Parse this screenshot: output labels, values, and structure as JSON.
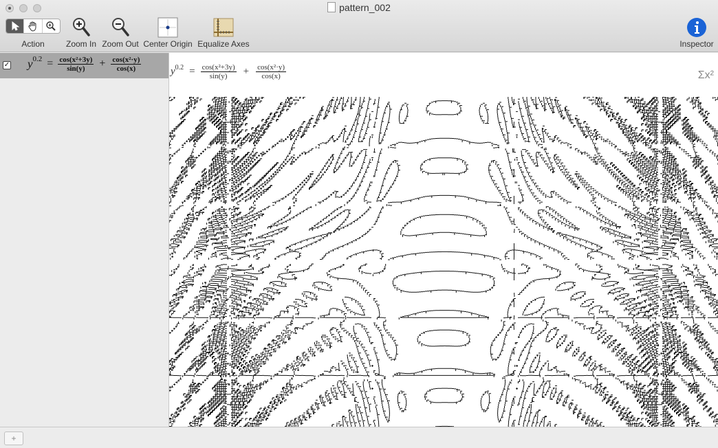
{
  "window": {
    "title": "pattern_002"
  },
  "toolbar": {
    "action_label": "Action",
    "zoom_in_label": "Zoom In",
    "zoom_out_label": "Zoom Out",
    "center_origin_label": "Center Origin",
    "equalize_axes_label": "Equalize Axes",
    "inspector_label": "Inspector"
  },
  "equation": {
    "checked": true,
    "lhs_base": "y",
    "lhs_exp": "0.2",
    "equals": "=",
    "plus": "+",
    "t1_num": "cos(x²+3y)",
    "t1_den": "sin(y)",
    "t2_num": "cos(x²·y)",
    "t2_den": "cos(x)"
  },
  "formula_bar": {
    "sigma": "Σx²"
  },
  "status": {
    "add_label": "+"
  },
  "colors": {
    "accent": "#1a63d6",
    "selected_row": "#a7a7a7",
    "plot_ink": "#111111"
  }
}
